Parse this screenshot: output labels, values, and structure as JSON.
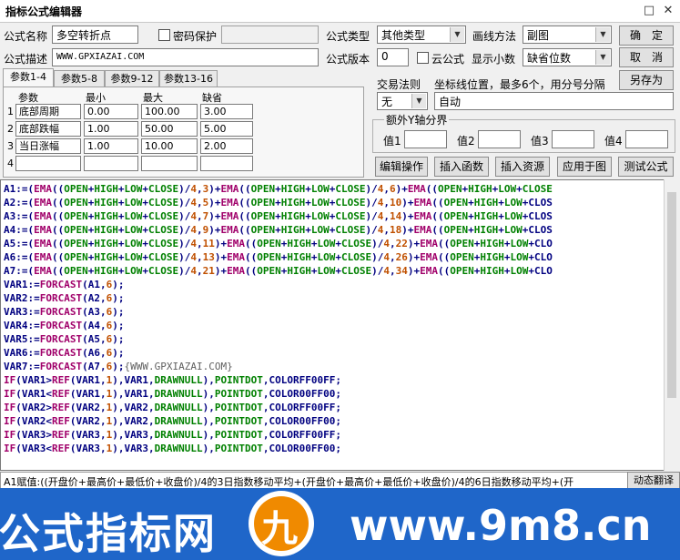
{
  "window": {
    "title": "指标公式编辑器",
    "maximize_glyph": "□",
    "close_glyph": "✕"
  },
  "form": {
    "name_label": "公式名称",
    "name_value": "多空转折点",
    "password_label": "密码保护",
    "desc_label": "公式描述",
    "desc_value": "WWW.GPXIAZAI.COM",
    "type_label": "公式类型",
    "type_value": "其他类型",
    "draw_label": "画线方法",
    "draw_value": "副图",
    "version_label": "公式版本",
    "version_value": "0",
    "cloud_label": "云公式",
    "decimal_label": "显示小数",
    "decimal_value": "缺省位数"
  },
  "buttons": {
    "ok": "确　定",
    "cancel": "取　消",
    "save_as": "另存为",
    "edit_ops": "编辑操作",
    "insert_func": "插入函数",
    "insert_res": "插入资源",
    "apply_chart": "应用于图",
    "test": "测试公式"
  },
  "tabs": [
    "参数1-4",
    "参数5-8",
    "参数9-12",
    "参数13-16"
  ],
  "params": {
    "headers": [
      "参数",
      "最小",
      "最大",
      "缺省"
    ],
    "rows": [
      {
        "idx": "1",
        "name": "底部周期",
        "min": "0.00",
        "max": "100.00",
        "def": "3.00"
      },
      {
        "idx": "2",
        "name": "底部跌幅",
        "min": "1.00",
        "max": "50.00",
        "def": "5.00"
      },
      {
        "idx": "3",
        "name": "当日涨幅",
        "min": "1.00",
        "max": "10.00",
        "def": "2.00"
      },
      {
        "idx": "4",
        "name": "",
        "min": "",
        "max": "",
        "def": ""
      }
    ]
  },
  "trade": {
    "rule_label": "交易法则",
    "rule_value": "无",
    "coord_label": "坐标线位置，最多6个，用分号分隔",
    "coord_value": "自动"
  },
  "yaxis": {
    "group_label": "额外Y轴分界",
    "v1": "值1",
    "v2": "值2",
    "v3": "值3",
    "v4": "值4"
  },
  "code_lines": [
    "A1:=(EMA((OPEN+HIGH+LOW+CLOSE)/4,3)+EMA((OPEN+HIGH+LOW+CLOSE)/4,6)+EMA((OPEN+HIGH+LOW+CLOSE",
    "A2:=(EMA((OPEN+HIGH+LOW+CLOSE)/4,5)+EMA((OPEN+HIGH+LOW+CLOSE)/4,10)+EMA((OPEN+HIGH+LOW+CLOS",
    "A3:=(EMA((OPEN+HIGH+LOW+CLOSE)/4,7)+EMA((OPEN+HIGH+LOW+CLOSE)/4,14)+EMA((OPEN+HIGH+LOW+CLOS",
    "A4:=(EMA((OPEN+HIGH+LOW+CLOSE)/4,9)+EMA((OPEN+HIGH+LOW+CLOSE)/4,18)+EMA((OPEN+HIGH+LOW+CLOS",
    "A5:=(EMA((OPEN+HIGH+LOW+CLOSE)/4,11)+EMA((OPEN+HIGH+LOW+CLOSE)/4,22)+EMA((OPEN+HIGH+LOW+CLO",
    "A6:=(EMA((OPEN+HIGH+LOW+CLOSE)/4,13)+EMA((OPEN+HIGH+LOW+CLOSE)/4,26)+EMA((OPEN+HIGH+LOW+CLO",
    "A7:=(EMA((OPEN+HIGH+LOW+CLOSE)/4,21)+EMA((OPEN+HIGH+LOW+CLOSE)/4,34)+EMA((OPEN+HIGH+LOW+CLO",
    "VAR1:=FORCAST(A1,6);",
    "VAR2:=FORCAST(A2,6);",
    "VAR3:=FORCAST(A3,6);",
    "VAR4:=FORCAST(A4,6);",
    "VAR5:=FORCAST(A5,6);",
    "VAR6:=FORCAST(A6,6);",
    "VAR7:=FORCAST(A7,6);{WWW.GPXIAZAI.COM}",
    "IF(VAR1>REF(VAR1,1),VAR1,DRAWNULL),POINTDOT,COLORFF00FF;",
    "IF(VAR1<REF(VAR1,1),VAR1,DRAWNULL),POINTDOT,COLOR00FF00;",
    "IF(VAR2>REF(VAR2,1),VAR2,DRAWNULL),POINTDOT,COLORFF00FF;",
    "IF(VAR2<REF(VAR2,1),VAR2,DRAWNULL),POINTDOT,COLOR00FF00;",
    "IF(VAR3>REF(VAR3,1),VAR3,DRAWNULL),POINTDOT,COLORFF00FF;",
    "IF(VAR3<REF(VAR3,1),VAR3,DRAWNULL),POINTDOT,COLOR00FF00;"
  ],
  "code_colors": {
    "ident": "#000080",
    "func": "#a0006a",
    "keyword": "#008000",
    "number": "#c05000",
    "comment": "#606060"
  },
  "status": {
    "text": "A1赋值:((开盘价+最高价+最低价+收盘价)/4的3日指数移动平均+(开盘价+最高价+最低价+收盘价)/4的6日指数移动平均+(开",
    "translate_btn": "动态翻译"
  },
  "banner": {
    "left_text": "公式指标网",
    "right_text": "www.9m8.cn",
    "logo_char": "九",
    "color": "#1f66c9"
  }
}
